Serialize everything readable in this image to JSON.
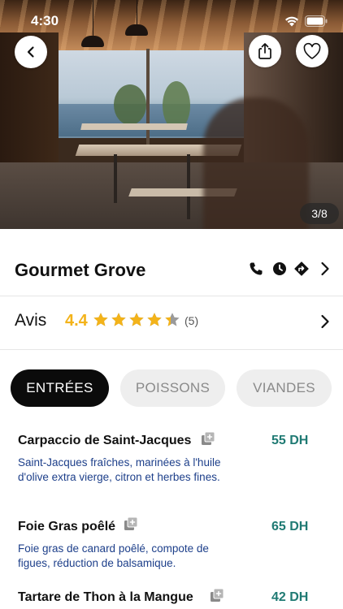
{
  "status_bar": {
    "time": "4:30"
  },
  "hero": {
    "photo_counter": "3/8"
  },
  "restaurant": {
    "name": "Gourmet Grove",
    "actions": [
      "phone-icon",
      "clock-icon",
      "directions-icon",
      "chevron-right-icon"
    ]
  },
  "reviews": {
    "label": "Avis",
    "rating": "4.4",
    "rating_value": 4.4,
    "count": "(5)",
    "star_color": "#f3b31a"
  },
  "tabs": [
    {
      "label": "ENTRÉES",
      "active": true
    },
    {
      "label": "POISSONS",
      "active": false
    },
    {
      "label": "VIANDES",
      "active": false
    }
  ],
  "menu": [
    {
      "name": "Carpaccio de Saint-Jacques",
      "price": "55 DH",
      "description": "Saint-Jacques fraîches, marinées à l'huile d'olive extra vierge, citron et herbes fines."
    },
    {
      "name": "Foie Gras poêlé",
      "price": "65 DH",
      "description": "Foie gras de canard poêlé, compote de figues, réduction de balsamique."
    },
    {
      "name": "Tartare de Thon à la Mangue",
      "price": "42 DH",
      "description": ""
    }
  ],
  "colors": {
    "price": "#1f7a73",
    "description": "#1d3f8a",
    "active_tab": "#0b0b0b",
    "inactive_tab": "#eeeeee"
  }
}
